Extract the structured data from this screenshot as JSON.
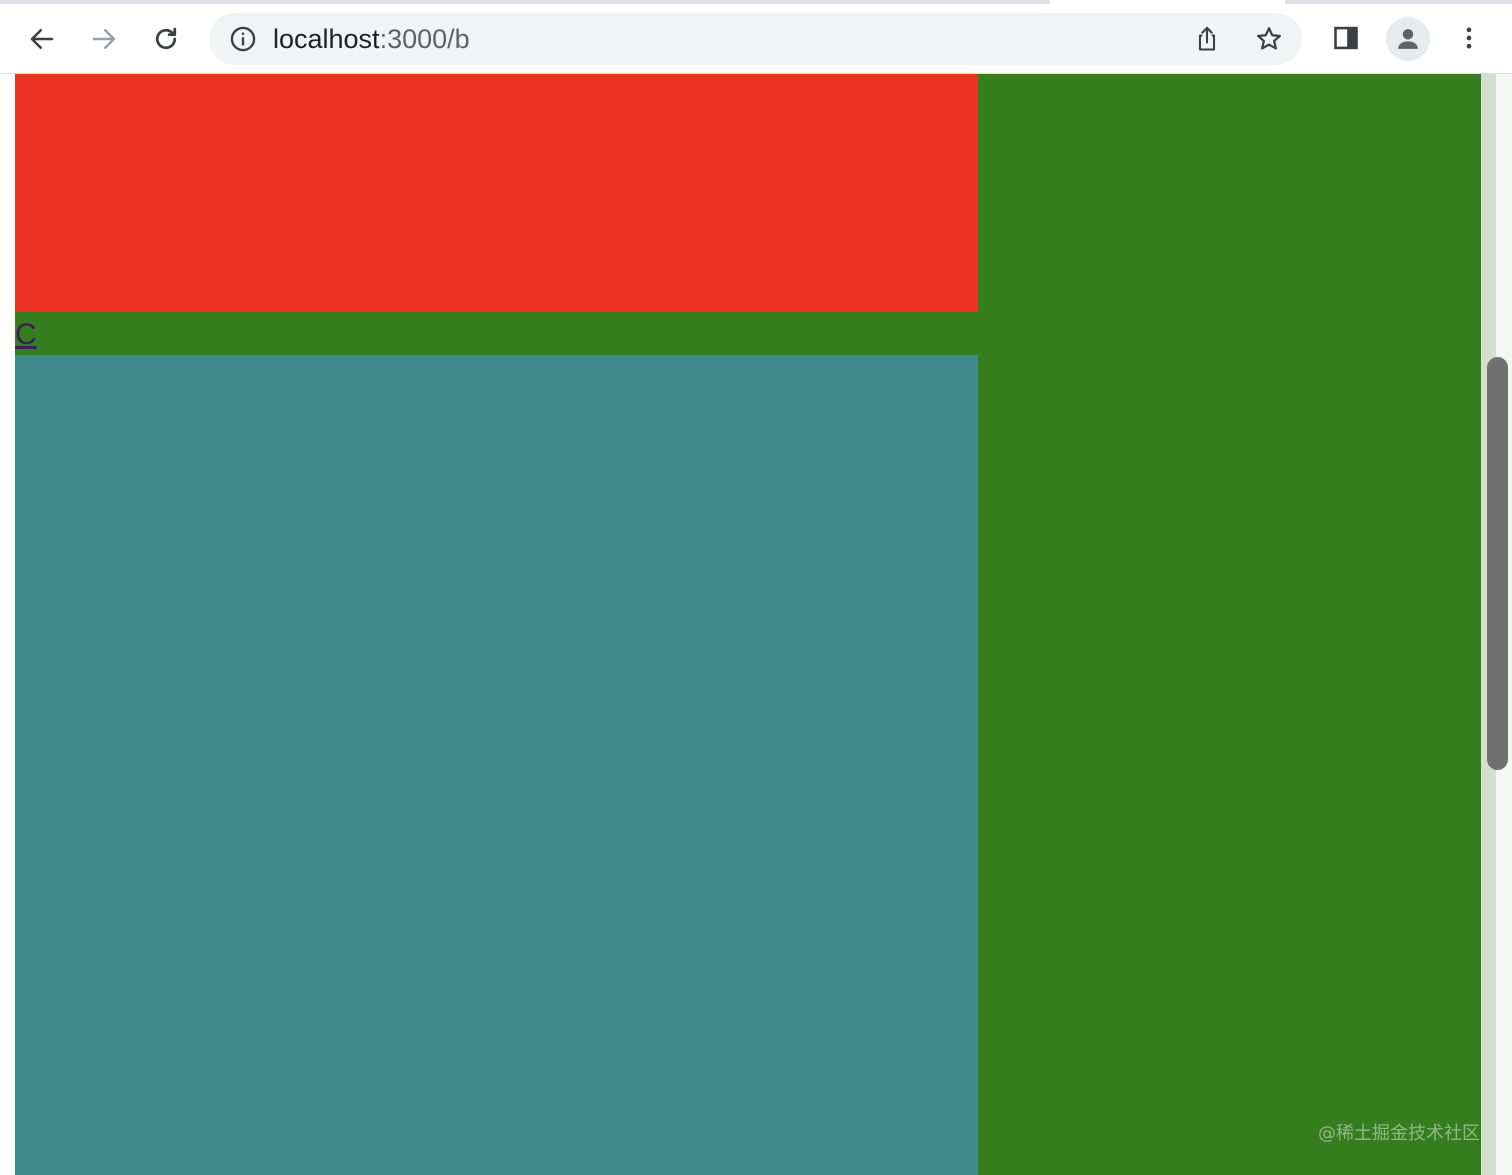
{
  "browser": {
    "url_host": "localhost",
    "url_path": ":3000/b"
  },
  "toolbar": {
    "icons": {
      "back": "arrow-left-icon",
      "forward": "arrow-right-icon",
      "reload": "reload-icon",
      "site_info": "info-icon",
      "share": "share-icon",
      "bookmark": "star-icon",
      "side_panel": "side-panel-icon",
      "profile": "person-icon",
      "menu": "kebab-menu-icon"
    }
  },
  "page": {
    "link_label": "C",
    "colors": {
      "red": "#ec3323",
      "green": "#367d20",
      "teal": "#3e8a8c",
      "link": "#3b1d5c"
    }
  },
  "watermark": {
    "text": "@稀土掘金技术社区"
  }
}
